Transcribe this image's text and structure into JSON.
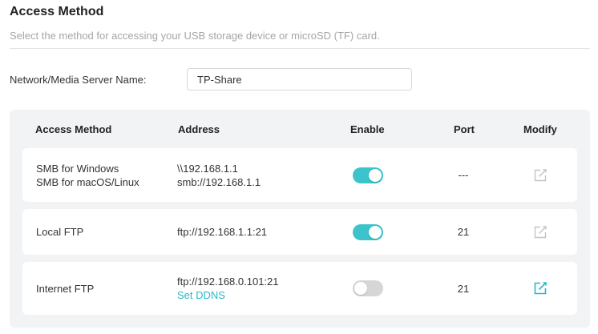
{
  "header": {
    "title": "Access Method",
    "subtitle": "Select the method for accessing your USB storage device or microSD (TF) card."
  },
  "server": {
    "label": "Network/Media Server Name:",
    "value": "TP-Share"
  },
  "table": {
    "columns": {
      "method": "Access Method",
      "address": "Address",
      "enable": "Enable",
      "port": "Port",
      "modify": "Modify"
    },
    "rows": [
      {
        "method_line1": "SMB for Windows",
        "method_line2": "SMB for macOS/Linux",
        "address_line1": "\\\\192.168.1.1",
        "address_line2": "smb://192.168.1.1",
        "enabled": true,
        "port": "---",
        "modify_enabled": false
      },
      {
        "method_line1": "Local FTP",
        "address_line1": "ftp://192.168.1.1:21",
        "enabled": true,
        "port": "21",
        "modify_enabled": false
      },
      {
        "method_line1": "Internet FTP",
        "address_line1": "ftp://192.168.0.101:21",
        "address_link": "Set DDNS",
        "enabled": false,
        "port": "21",
        "modify_enabled": true
      }
    ]
  },
  "colors": {
    "accent": "#3cc3cb",
    "link": "#2bb7c9",
    "toggle_off": "#d6d6d6",
    "icon_disabled": "#c4c4c4",
    "panel_bg": "#f2f3f5"
  },
  "icons": {
    "modify": "edit-icon"
  }
}
